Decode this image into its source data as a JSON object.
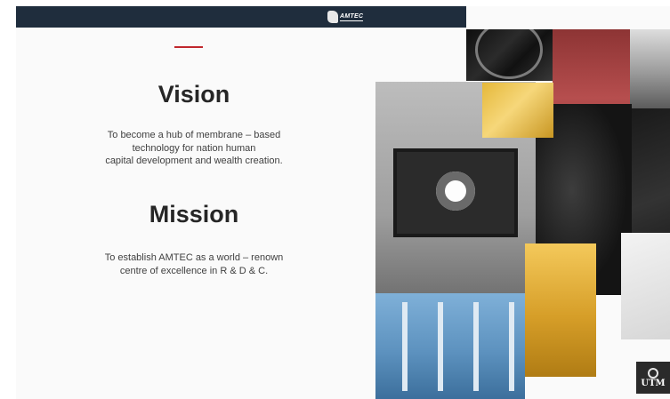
{
  "header": {
    "logo_text": "AMTEC"
  },
  "vision": {
    "title": "Vision",
    "lines": [
      "To become a hub of membrane  – based",
      "technology for nation human",
      "capital development  and wealth creation."
    ]
  },
  "mission": {
    "title": "Mission",
    "lines": [
      "To establish AMTEC  as a world – renown",
      "centre of excellence  in R & D & C."
    ]
  },
  "footer_logo": {
    "text": "UTM"
  },
  "colors": {
    "accent_red": "#c0272d",
    "topbar": "#1f2d3d"
  }
}
